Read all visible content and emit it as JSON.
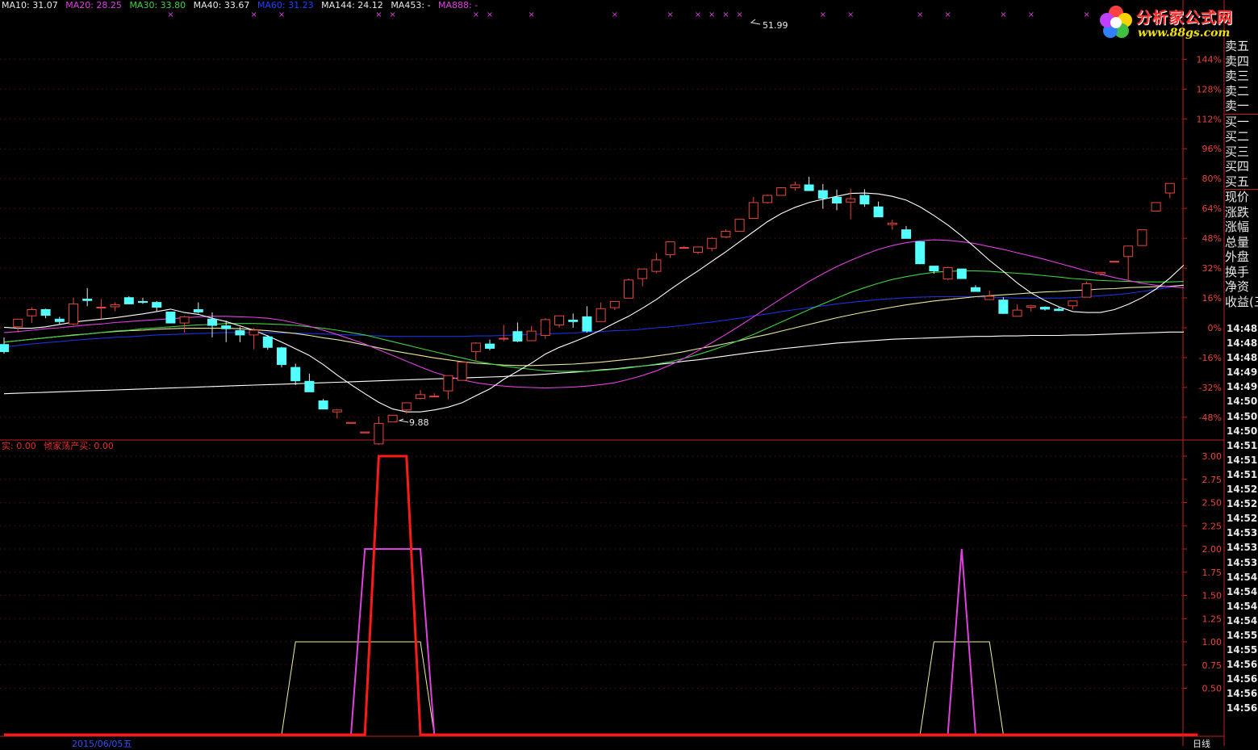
{
  "colors": {
    "up": "#e8463c",
    "down": "#54ffff",
    "grid": "#7a1010",
    "axis": "#c02020",
    "ma10": "#ffffff",
    "ma20": "#e040e0",
    "ma30": "#40d040",
    "ma40": "#e8e8a0",
    "ma60": "#1c30e0",
    "ma144": "#ffffff",
    "signal_red": "#ff1a1a",
    "signal_magenta": "#e040e0",
    "signal_yellow": "#f0f0a0"
  },
  "legend": {
    "ma10": "MA10: 31.07",
    "ma20": "MA20: 28.25",
    "ma30": "MA30: 33.80",
    "ma40": "MA40: 33.67",
    "ma60": "MA60: 31.23",
    "ma144": "MA144: 24.12",
    "ma453": "MA453: -",
    "ma888": "MA888: -"
  },
  "indicator_legend": {
    "a": "实: 0.00",
    "b": "倾家荡产买: 0.00"
  },
  "logo": {
    "title": "分析家公式网",
    "url": "www.88gs.com"
  },
  "annotations": {
    "high": "51.99",
    "low": "9.88"
  },
  "price_axis_labels": [
    "144%",
    "128%",
    "112%",
    "96%",
    "80%",
    "64%",
    "48%",
    "32%",
    "16%",
    "0%",
    "-16%",
    "-32%",
    "-48%"
  ],
  "indicator_axis_labels": [
    "3.00",
    "2.75",
    "2.50",
    "2.25",
    "2.00",
    "1.75",
    "1.50",
    "1.25",
    "1.00",
    "0.75",
    "0.50"
  ],
  "side_panel": [
    "卖五",
    "卖四",
    "卖三",
    "卖二",
    "卖一",
    "买一",
    "买二",
    "买三",
    "买四",
    "买五",
    "现价",
    "涨跌",
    "涨幅",
    "总量",
    "外盘",
    "换手",
    "净资",
    "收益(三)"
  ],
  "time_labels": [
    "14:48",
    "14:48",
    "14:48",
    "14:49",
    "14:49",
    "14:50",
    "14:50",
    "14:50",
    "14:51",
    "14:51",
    "14:51",
    "14:52",
    "14:52",
    "14:52",
    "14:53",
    "14:53",
    "14:53",
    "14:54",
    "14:54",
    "14:54",
    "14:54",
    "14:55",
    "14:55",
    "14:56",
    "14:56",
    "14:56",
    "14:56"
  ],
  "bottom": {
    "date": "2015/06/05五",
    "right": "日线"
  },
  "chart_data": {
    "type": "candlestick",
    "candles": [
      {
        "o": 21.5,
        "h": 23.0,
        "l": 19.6,
        "c": 20.0
      },
      {
        "o": 25.2,
        "h": 26.0,
        "l": 24.0,
        "c": 26.8
      },
      {
        "o": 27.5,
        "h": 29.3,
        "l": 26.0,
        "c": 28.8
      },
      {
        "o": 28.8,
        "h": 29.0,
        "l": 27.0,
        "c": 27.6
      },
      {
        "o": 26.8,
        "h": 27.3,
        "l": 25.6,
        "c": 26.3
      },
      {
        "o": 25.8,
        "h": 31.3,
        "l": 25.5,
        "c": 30.0
      },
      {
        "o": 31.0,
        "h": 33.3,
        "l": 29.5,
        "c": 30.7
      },
      {
        "o": 29.3,
        "h": 31.0,
        "l": 26.8,
        "c": 29.3
      },
      {
        "o": 29.4,
        "h": 30.3,
        "l": 28.5,
        "c": 29.8
      },
      {
        "o": 31.3,
        "h": 31.6,
        "l": 30.4,
        "c": 30.0
      },
      {
        "o": 30.5,
        "h": 31.3,
        "l": 30.0,
        "c": 30.3
      },
      {
        "o": 30.3,
        "h": 30.6,
        "l": 28.5,
        "c": 29.3
      },
      {
        "o": 28.3,
        "h": 28.3,
        "l": 26.3,
        "c": 26.0
      },
      {
        "o": 26.0,
        "h": 27.5,
        "l": 24.0,
        "c": 27.3
      },
      {
        "o": 28.8,
        "h": 30.3,
        "l": 28.0,
        "c": 28.3
      },
      {
        "o": 26.8,
        "h": 28.2,
        "l": 23.0,
        "c": 25.5
      },
      {
        "o": 25.4,
        "h": 26.5,
        "l": 22.0,
        "c": 24.8
      },
      {
        "o": 24.4,
        "h": 25.2,
        "l": 22.0,
        "c": 23.5
      },
      {
        "o": 23.5,
        "h": 25.0,
        "l": 20.5,
        "c": 24.5
      },
      {
        "o": 23.1,
        "h": 23.5,
        "l": 20.4,
        "c": 20.9
      },
      {
        "o": 20.8,
        "h": 21.0,
        "l": 16.7,
        "c": 17.3
      },
      {
        "o": 16.7,
        "h": 17.5,
        "l": 13.0,
        "c": 13.9
      },
      {
        "o": 13.8,
        "h": 15.4,
        "l": 11.6,
        "c": 11.6
      },
      {
        "o": 9.7,
        "h": 10.1,
        "l": 8.5,
        "c": 8.0
      },
      {
        "o": 7.4,
        "h": 8.0,
        "l": 6.0,
        "c": 7.8
      },
      {
        "o": 5.0,
        "h": 5.1,
        "l": 5.0,
        "c": 5.2
      },
      {
        "o": 3.0,
        "h": 3.2,
        "l": 3.0,
        "c": 3.2
      },
      {
        "o": 0.7,
        "h": 6.4,
        "l": 0.5,
        "c": 5.0
      },
      {
        "o": 5.3,
        "h": 6.7,
        "l": 5.3,
        "c": 6.7
      },
      {
        "o": 7.8,
        "h": 9.3,
        "l": 7.0,
        "c": 9.3
      },
      {
        "o": 10.2,
        "h": 12.0,
        "l": 10.0,
        "c": 11.0
      },
      {
        "o": 10.7,
        "h": 11.3,
        "l": 10.5,
        "c": 10.7
      },
      {
        "o": 11.8,
        "h": 15.0,
        "l": 10.0,
        "c": 15.0
      },
      {
        "o": 14.0,
        "h": 17.8,
        "l": 14.0,
        "c": 17.8
      },
      {
        "o": 20.0,
        "h": 22.0,
        "l": 18.0,
        "c": 21.8
      },
      {
        "o": 21.6,
        "h": 22.5,
        "l": 20.3,
        "c": 20.7
      },
      {
        "o": 22.7,
        "h": 25.6,
        "l": 22.2,
        "c": 22.8
      },
      {
        "o": 24.2,
        "h": 26.1,
        "l": 22.0,
        "c": 22.2
      },
      {
        "o": 22.3,
        "h": 25.4,
        "l": 22.3,
        "c": 24.3
      },
      {
        "o": 23.4,
        "h": 27.0,
        "l": 22.7,
        "c": 26.7
      },
      {
        "o": 25.6,
        "h": 27.5,
        "l": 25.0,
        "c": 27.5
      },
      {
        "o": 26.6,
        "h": 28.0,
        "l": 25.0,
        "c": 26.3
      },
      {
        "o": 27.3,
        "h": 29.5,
        "l": 24.0,
        "c": 24.3
      },
      {
        "o": 26.3,
        "h": 30.3,
        "l": 26.3,
        "c": 29.0
      },
      {
        "o": 29.2,
        "h": 30.5,
        "l": 28.7,
        "c": 30.5
      },
      {
        "o": 31.2,
        "h": 35.3,
        "l": 31.2,
        "c": 35.0
      },
      {
        "o": 35.3,
        "h": 37.3,
        "l": 33.7,
        "c": 37.3
      },
      {
        "o": 36.8,
        "h": 40.6,
        "l": 36.4,
        "c": 39.2
      },
      {
        "o": 40.3,
        "h": 43.0,
        "l": 39.6,
        "c": 43.0
      },
      {
        "o": 41.8,
        "h": 42.1,
        "l": 41.6,
        "c": 41.8
      },
      {
        "o": 40.8,
        "h": 42.0,
        "l": 40.4,
        "c": 41.9
      },
      {
        "o": 41.6,
        "h": 44.0,
        "l": 41.0,
        "c": 43.7
      },
      {
        "o": 44.0,
        "h": 45.6,
        "l": 43.8,
        "c": 45.2
      },
      {
        "o": 45.2,
        "h": 47.7,
        "l": 45.2,
        "c": 47.7
      },
      {
        "o": 47.9,
        "h": 52.4,
        "l": 47.9,
        "c": 51.2
      },
      {
        "o": 51.2,
        "h": 52.9,
        "l": 51.0,
        "c": 52.7
      },
      {
        "o": 52.7,
        "h": 54.3,
        "l": 52.7,
        "c": 54.3
      },
      {
        "o": 54.3,
        "h": 55.6,
        "l": 53.7,
        "c": 54.9
      },
      {
        "o": 54.9,
        "h": 56.6,
        "l": 53.7,
        "c": 53.7
      },
      {
        "o": 53.7,
        "h": 55.1,
        "l": 49.9,
        "c": 52.1
      },
      {
        "o": 52.3,
        "h": 53.9,
        "l": 49.6,
        "c": 51.1
      },
      {
        "o": 51.3,
        "h": 54.1,
        "l": 47.7,
        "c": 52.0
      },
      {
        "o": 52.7,
        "h": 54.0,
        "l": 50.3,
        "c": 50.9
      },
      {
        "o": 50.3,
        "h": 51.4,
        "l": 48.2,
        "c": 48.2
      },
      {
        "o": 46.6,
        "h": 47.6,
        "l": 45.5,
        "c": 46.9
      },
      {
        "o": 45.5,
        "h": 46.3,
        "l": 43.7,
        "c": 43.7
      },
      {
        "o": 43.0,
        "h": 43.0,
        "l": 38.3,
        "c": 38.4
      },
      {
        "o": 37.9,
        "h": 37.9,
        "l": 36.3,
        "c": 36.9
      },
      {
        "o": 35.2,
        "h": 37.8,
        "l": 35.0,
        "c": 37.6
      },
      {
        "o": 37.3,
        "h": 37.3,
        "l": 35.2,
        "c": 35.3
      },
      {
        "o": 33.4,
        "h": 33.9,
        "l": 32.6,
        "c": 32.6
      },
      {
        "o": 30.9,
        "h": 32.8,
        "l": 30.9,
        "c": 31.6
      },
      {
        "o": 30.8,
        "h": 31.4,
        "l": 27.9,
        "c": 28.0
      },
      {
        "o": 27.4,
        "h": 29.9,
        "l": 27.4,
        "c": 28.7
      },
      {
        "o": 29.3,
        "h": 29.8,
        "l": 28.4,
        "c": 29.6
      },
      {
        "o": 29.3,
        "h": 29.5,
        "l": 28.6,
        "c": 28.9
      },
      {
        "o": 28.9,
        "h": 29.3,
        "l": 28.5,
        "c": 28.6
      },
      {
        "o": 29.6,
        "h": 30.6,
        "l": 28.8,
        "c": 30.6
      },
      {
        "o": 31.4,
        "h": 34.7,
        "l": 31.4,
        "c": 34.2
      },
      {
        "o": 36.3,
        "h": 36.6,
        "l": 35.9,
        "c": 36.6
      },
      {
        "o": 38.9,
        "h": 39.0,
        "l": 38.9,
        "c": 38.9
      },
      {
        "o": 39.9,
        "h": 42.1,
        "l": 34.7,
        "c": 42.1
      },
      {
        "o": 42.2,
        "h": 45.5,
        "l": 42.2,
        "c": 45.5
      },
      {
        "o": 49.4,
        "h": 51.2,
        "l": 49.3,
        "c": 51.2
      },
      {
        "o": 53.2,
        "h": 55.2,
        "l": 52.1,
        "c": 55.2
      }
    ],
    "ma_series": {
      "ma10": [
        25.1,
        24.9,
        24.9,
        25.2,
        25.7,
        26.2,
        26.5,
        26.8,
        27.1,
        27.5,
        27.9,
        28.4,
        28.9,
        28.2,
        27.8,
        27.0,
        26.3,
        25.4,
        24.5,
        23.3,
        22.0,
        20.6,
        19.2,
        17.3,
        15.1,
        13.1,
        11.2,
        9.4,
        8.0,
        7.4,
        7.4,
        7.8,
        8.4,
        9.3,
        10.8,
        12.2,
        14.2,
        15.9,
        17.6,
        19.5,
        20.9,
        22.0,
        23.2,
        24.5,
        26.0,
        27.4,
        29.1,
        30.9,
        33.0,
        35.0,
        36.9,
        38.9,
        40.9,
        43.0,
        45.1,
        47.2,
        48.9,
        50.2,
        51.2,
        51.9,
        52.5,
        53.1,
        53.2,
        53.0,
        52.5,
        51.7,
        50.3,
        48.5,
        46.5,
        44.2,
        41.7,
        39.1,
        36.8,
        34.4,
        32.3,
        30.7,
        29.4,
        28.4,
        28.2,
        28.2,
        28.8,
        29.9,
        31.3,
        33.1,
        35.4,
        38.1
      ],
      "ma20": [
        24.0,
        24.2,
        24.5,
        24.8,
        25.0,
        25.3,
        25.6,
        25.8,
        26.1,
        26.3,
        26.5,
        26.7,
        26.9,
        27.1,
        27.3,
        27.4,
        27.4,
        27.3,
        27.2,
        27.0,
        26.6,
        26.0,
        25.3,
        24.5,
        23.6,
        22.6,
        21.6,
        20.4,
        19.2,
        18.0,
        16.8,
        15.7,
        14.8,
        14.1,
        13.5,
        13.1,
        12.8,
        12.6,
        12.5,
        12.4,
        12.5,
        12.6,
        12.8,
        13.1,
        13.5,
        14.2,
        15.0,
        16.0,
        17.2,
        18.6,
        20.2,
        21.9,
        23.6,
        25.4,
        27.3,
        29.2,
        31.1,
        32.9,
        34.7,
        36.3,
        37.8,
        39.1,
        40.3,
        41.4,
        42.2,
        42.8,
        43.2,
        43.4,
        43.3,
        43.0,
        42.6,
        42.0,
        41.4,
        40.7,
        40.0,
        39.3,
        38.5,
        37.7,
        36.9,
        36.2,
        35.5,
        34.9,
        34.3,
        33.9,
        33.6,
        33.4
      ],
      "ma30": [
        22.0,
        22.3,
        22.6,
        22.9,
        23.2,
        23.4,
        23.7,
        24.0,
        24.3,
        24.5,
        24.8,
        25.0,
        25.2,
        25.4,
        25.6,
        25.7,
        25.9,
        25.9,
        25.9,
        25.8,
        25.7,
        25.5,
        25.2,
        24.9,
        24.5,
        24.0,
        23.5,
        22.8,
        22.1,
        21.4,
        20.7,
        20.0,
        19.3,
        18.7,
        18.0,
        17.5,
        17.0,
        16.6,
        16.3,
        16.0,
        15.9,
        15.9,
        15.9,
        16.1,
        16.3,
        16.6,
        17.0,
        17.4,
        17.9,
        18.6,
        19.4,
        20.3,
        21.3,
        22.4,
        23.6,
        24.9,
        26.2,
        27.5,
        28.8,
        30.0,
        31.2,
        32.4,
        33.4,
        34.3,
        35.1,
        35.7,
        36.2,
        36.6,
        36.8,
        36.9,
        36.9,
        36.8,
        36.6,
        36.4,
        36.2,
        35.9,
        35.6,
        35.3,
        35.1,
        34.9,
        34.8,
        34.7,
        34.6,
        34.6,
        34.6,
        34.7
      ],
      "ma40": [
        22.0,
        22.3,
        22.6,
        22.9,
        23.2,
        23.5,
        23.7,
        24.0,
        24.2,
        24.4,
        24.5,
        24.7,
        24.8,
        24.9,
        24.9,
        24.9,
        24.9,
        24.8,
        24.6,
        24.4,
        24.1,
        23.8,
        23.4,
        22.9,
        22.5,
        22.0,
        21.4,
        20.8,
        20.2,
        19.7,
        19.2,
        18.7,
        18.3,
        17.9,
        17.6,
        17.4,
        17.2,
        17.1,
        17.1,
        17.2,
        17.3,
        17.4,
        17.6,
        17.8,
        18.1,
        18.4,
        18.7,
        19.1,
        19.5,
        20.0,
        20.6,
        21.1,
        21.7,
        22.3,
        23.0,
        23.6,
        24.3,
        25.0,
        25.7,
        26.4,
        27.1,
        27.7,
        28.3,
        28.8,
        29.3,
        29.8,
        30.2,
        30.6,
        30.9,
        31.2,
        31.5,
        31.7,
        31.9,
        32.1,
        32.3,
        32.5,
        32.6,
        32.8,
        32.9,
        33.1,
        33.2,
        33.4,
        33.5,
        33.6,
        33.7,
        33.9
      ],
      "ma60": [
        21.0,
        21.3,
        21.6,
        21.9,
        22.1,
        22.4,
        22.6,
        22.8,
        23.0,
        23.1,
        23.3,
        23.5,
        23.6,
        23.7,
        23.8,
        23.9,
        24.0,
        24.0,
        24.0,
        24.0,
        23.9,
        23.9,
        23.8,
        23.7,
        23.6,
        23.5,
        23.4,
        23.3,
        23.2,
        23.2,
        23.2,
        23.2,
        23.2,
        23.2,
        23.3,
        23.3,
        23.4,
        23.5,
        23.6,
        23.7,
        23.8,
        23.9,
        24.1,
        24.2,
        24.4,
        24.5,
        24.7,
        25.0,
        25.2,
        25.5,
        25.9,
        26.2,
        26.6,
        27.0,
        27.5,
        27.9,
        28.4,
        28.8,
        29.2,
        29.6,
        30.0,
        30.3,
        30.6,
        30.9,
        31.1,
        31.3,
        31.4,
        31.5,
        31.5,
        31.5,
        31.5,
        31.4,
        31.3,
        31.2,
        31.2,
        31.2,
        31.2,
        31.3,
        31.5,
        31.7,
        31.9,
        32.2,
        32.6,
        33.0,
        33.5,
        34.0
      ],
      "ma144": [
        11.2,
        11.3,
        11.4,
        11.5,
        11.6,
        11.7,
        11.8,
        11.9,
        12.0,
        12.1,
        12.2,
        12.3,
        12.4,
        12.5,
        12.6,
        12.7,
        12.8,
        12.9,
        13.0,
        13.1,
        13.2,
        13.3,
        13.4,
        13.5,
        13.6,
        13.7,
        13.8,
        13.9,
        14.0,
        14.1,
        14.2,
        14.3,
        14.4,
        14.5,
        14.6,
        14.7,
        14.8,
        15.0,
        15.1,
        15.3,
        15.5,
        15.7,
        15.9,
        16.2,
        16.4,
        16.7,
        17.0,
        17.3,
        17.6,
        18.0,
        18.3,
        18.7,
        19.1,
        19.5,
        19.9,
        20.2,
        20.6,
        20.9,
        21.2,
        21.5,
        21.8,
        22.0,
        22.2,
        22.4,
        22.6,
        22.7,
        22.8,
        22.9,
        23.0,
        23.1,
        23.2,
        23.2,
        23.3,
        23.3,
        23.4,
        23.4,
        23.4,
        23.5,
        23.5,
        23.6,
        23.7,
        23.8,
        23.9,
        24.0,
        24.1,
        24.1
      ]
    },
    "indicator_series": {
      "signal_red": [
        [
          0,
          0
        ],
        [
          26,
          0
        ],
        [
          27,
          3
        ],
        [
          29,
          3
        ],
        [
          30,
          0
        ],
        [
          86,
          0
        ]
      ],
      "signal_magenta": [
        [
          0,
          0
        ],
        [
          25,
          0
        ],
        [
          26,
          2
        ],
        [
          30,
          2
        ],
        [
          31,
          0
        ],
        [
          68,
          0
        ],
        [
          69,
          2
        ],
        [
          70,
          0
        ],
        [
          86,
          0
        ]
      ],
      "signal_yellow": [
        [
          0,
          0
        ],
        [
          20,
          0
        ],
        [
          21,
          1
        ],
        [
          30,
          1
        ],
        [
          31,
          0
        ],
        [
          66,
          0
        ],
        [
          67,
          1
        ],
        [
          71,
          1
        ],
        [
          72,
          0
        ],
        [
          86,
          0
        ]
      ]
    },
    "signal_markers": [
      12,
      18,
      20,
      27,
      28,
      34,
      35,
      38,
      44,
      48,
      50,
      51,
      52,
      53,
      59,
      61,
      66,
      68,
      72,
      74,
      78
    ]
  }
}
